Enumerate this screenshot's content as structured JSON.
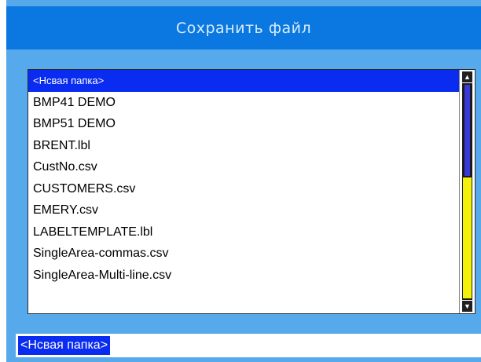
{
  "dialog": {
    "title": "Сохранить файл"
  },
  "file_list": {
    "items": [
      {
        "label": "<Нсвая папка>",
        "selected": true
      },
      {
        "label": "BMP41 DEMO",
        "selected": false
      },
      {
        "label": "BMP51 DEMO",
        "selected": false
      },
      {
        "label": "BRENT.lbl",
        "selected": false
      },
      {
        "label": "CustNo.csv",
        "selected": false
      },
      {
        "label": "CUSTOMERS.csv",
        "selected": false
      },
      {
        "label": "EMERY.csv",
        "selected": false
      },
      {
        "label": "LABELTEMPLATE.lbl",
        "selected": false
      },
      {
        "label": "SingleArea-commas.csv",
        "selected": false
      },
      {
        "label": "SingleArea-Multi-line.csv",
        "selected": false
      }
    ]
  },
  "scrollbar": {
    "up_icon": "scroll-up-arrow-icon",
    "down_icon": "scroll-down-arrow-icon",
    "thumb_color": "#f4f20a"
  },
  "filename_input": {
    "value": "<Нсвая папка>"
  },
  "colors": {
    "title_bar": "#0a78e0",
    "background": "#56a9ea",
    "selection": "#0a2cf0"
  }
}
